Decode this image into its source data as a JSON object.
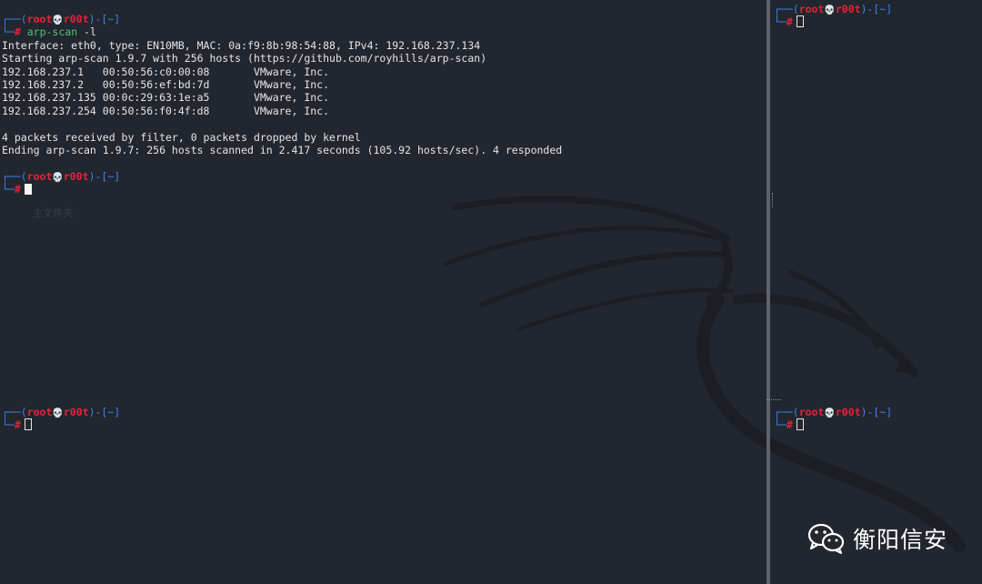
{
  "prompt": {
    "open": "┌──(",
    "user": "root",
    "skull": "💀",
    "host": "r00t",
    "mid": ")-[",
    "cwd": "~",
    "close": "]",
    "corner": "└─",
    "hash": "#"
  },
  "panes": {
    "top_left": {
      "command": "arp-scan",
      "command_arg": " -l",
      "output_lines": [
        "Interface: eth0, type: EN10MB, MAC: 0a:f9:8b:98:54:88, IPv4: 192.168.237.134",
        "Starting arp-scan 1.9.7 with 256 hosts (https://github.com/royhills/arp-scan)",
        "192.168.237.1   00:50:56:c0:00:08       VMware, Inc.",
        "192.168.237.2   00:50:56:ef:bd:7d       VMware, Inc.",
        "192.168.237.135 00:0c:29:63:1e:a5       VMware, Inc.",
        "192.168.237.254 00:50:56:f0:4f:d8       VMware, Inc.",
        "",
        "4 packets received by filter, 0 packets dropped by kernel",
        "Ending arp-scan 1.9.7: 256 hosts scanned in 2.417 seconds (105.92 hosts/sec). 4 responded"
      ]
    }
  },
  "desktop": {
    "ghost_label": "主文件夹"
  },
  "watermark": {
    "text": "衡阳信安",
    "icon": "wechat-icon"
  },
  "colors": {
    "background": "#22262e",
    "prompt_blue": "#3b82f0",
    "prompt_red": "#e8213a",
    "command_green": "#4dc57b",
    "divider": "#5e636b"
  }
}
